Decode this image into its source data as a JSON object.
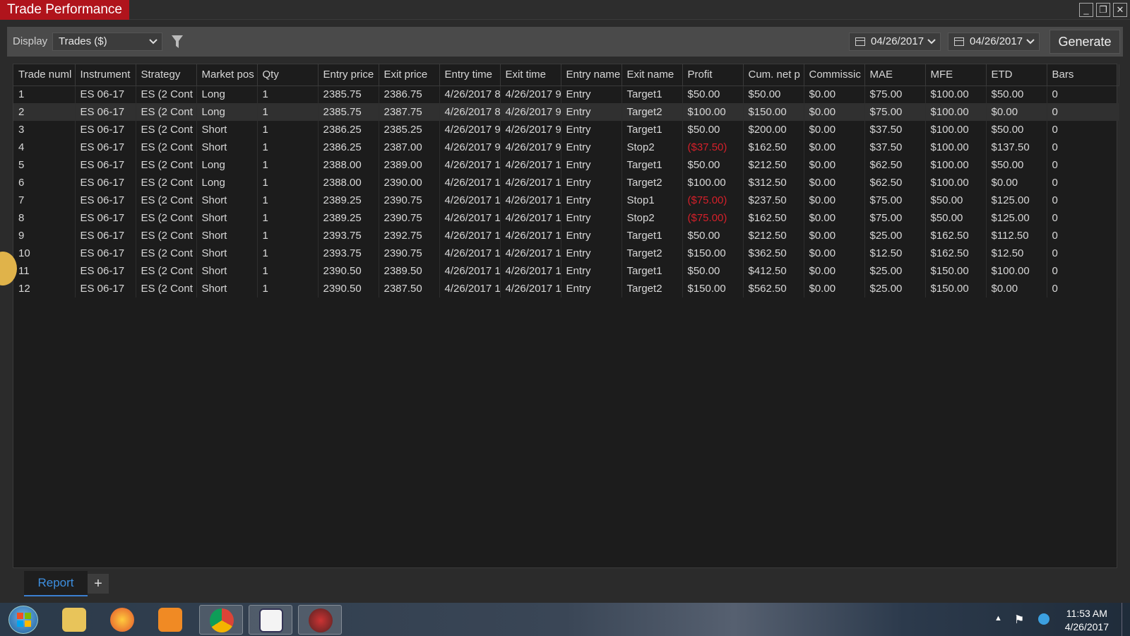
{
  "window": {
    "title": "Trade Performance",
    "controls": {
      "minimize": "_",
      "restore": "❐",
      "close": "✕"
    }
  },
  "toolbar": {
    "display_label": "Display",
    "display_value": "Trades ($)",
    "date_from": "04/26/2017",
    "date_to": "04/26/2017",
    "generate_label": "Generate",
    "icons": [
      "chevron-down-icon",
      "filter-icon",
      "calendar-icon"
    ]
  },
  "grid": {
    "columns": [
      "Trade numl",
      "Instrument",
      "Strategy",
      "Market pos",
      "Qty",
      "Entry price",
      "Exit price",
      "Entry time",
      "Exit time",
      "Entry name",
      "Exit name",
      "Profit",
      "Cum. net p",
      "Commissic",
      "MAE",
      "MFE",
      "ETD",
      "Bars"
    ],
    "selected_row": 1,
    "rows": [
      [
        "1",
        "ES 06-17",
        "ES (2 Cont",
        "Long",
        "1",
        "2385.75",
        "2386.75",
        "4/26/2017 8",
        "4/26/2017 9",
        "Entry",
        "Target1",
        "$50.00",
        "$50.00",
        "$0.00",
        "$75.00",
        "$100.00",
        "$50.00",
        "0"
      ],
      [
        "2",
        "ES 06-17",
        "ES (2 Cont",
        "Long",
        "1",
        "2385.75",
        "2387.75",
        "4/26/2017 8",
        "4/26/2017 9",
        "Entry",
        "Target2",
        "$100.00",
        "$150.00",
        "$0.00",
        "$75.00",
        "$100.00",
        "$0.00",
        "0"
      ],
      [
        "3",
        "ES 06-17",
        "ES (2 Cont",
        "Short",
        "1",
        "2386.25",
        "2385.25",
        "4/26/2017 9",
        "4/26/2017 9",
        "Entry",
        "Target1",
        "$50.00",
        "$200.00",
        "$0.00",
        "$37.50",
        "$100.00",
        "$50.00",
        "0"
      ],
      [
        "4",
        "ES 06-17",
        "ES (2 Cont",
        "Short",
        "1",
        "2386.25",
        "2387.00",
        "4/26/2017 9",
        "4/26/2017 9",
        "Entry",
        "Stop2",
        "($37.50)",
        "$162.50",
        "$0.00",
        "$37.50",
        "$100.00",
        "$137.50",
        "0"
      ],
      [
        "5",
        "ES 06-17",
        "ES (2 Cont",
        "Long",
        "1",
        "2388.00",
        "2389.00",
        "4/26/2017 1",
        "4/26/2017 1",
        "Entry",
        "Target1",
        "$50.00",
        "$212.50",
        "$0.00",
        "$62.50",
        "$100.00",
        "$50.00",
        "0"
      ],
      [
        "6",
        "ES 06-17",
        "ES (2 Cont",
        "Long",
        "1",
        "2388.00",
        "2390.00",
        "4/26/2017 1",
        "4/26/2017 1",
        "Entry",
        "Target2",
        "$100.00",
        "$312.50",
        "$0.00",
        "$62.50",
        "$100.00",
        "$0.00",
        "0"
      ],
      [
        "7",
        "ES 06-17",
        "ES (2 Cont",
        "Short",
        "1",
        "2389.25",
        "2390.75",
        "4/26/2017 1",
        "4/26/2017 1",
        "Entry",
        "Stop1",
        "($75.00)",
        "$237.50",
        "$0.00",
        "$75.00",
        "$50.00",
        "$125.00",
        "0"
      ],
      [
        "8",
        "ES 06-17",
        "ES (2 Cont",
        "Short",
        "1",
        "2389.25",
        "2390.75",
        "4/26/2017 1",
        "4/26/2017 1",
        "Entry",
        "Stop2",
        "($75.00)",
        "$162.50",
        "$0.00",
        "$75.00",
        "$50.00",
        "$125.00",
        "0"
      ],
      [
        "9",
        "ES 06-17",
        "ES (2 Cont",
        "Short",
        "1",
        "2393.75",
        "2392.75",
        "4/26/2017 1",
        "4/26/2017 1",
        "Entry",
        "Target1",
        "$50.00",
        "$212.50",
        "$0.00",
        "$25.00",
        "$162.50",
        "$112.50",
        "0"
      ],
      [
        "10",
        "ES 06-17",
        "ES (2 Cont",
        "Short",
        "1",
        "2393.75",
        "2390.75",
        "4/26/2017 1",
        "4/26/2017 1",
        "Entry",
        "Target2",
        "$150.00",
        "$362.50",
        "$0.00",
        "$12.50",
        "$162.50",
        "$12.50",
        "0"
      ],
      [
        "11",
        "ES 06-17",
        "ES (2 Cont",
        "Short",
        "1",
        "2390.50",
        "2389.50",
        "4/26/2017 1",
        "4/26/2017 1",
        "Entry",
        "Target1",
        "$50.00",
        "$412.50",
        "$0.00",
        "$25.00",
        "$150.00",
        "$100.00",
        "0"
      ],
      [
        "12",
        "ES 06-17",
        "ES (2 Cont",
        "Short",
        "1",
        "2390.50",
        "2387.50",
        "4/26/2017 1",
        "4/26/2017 1",
        "Entry",
        "Target2",
        "$150.00",
        "$562.50",
        "$0.00",
        "$25.00",
        "$150.00",
        "$0.00",
        "0"
      ]
    ]
  },
  "tabs": {
    "report_label": "Report",
    "add_label": "+"
  },
  "colors": {
    "title_tab": "#b0141c",
    "negative": "#d4202a",
    "active_tab": "#3d8fe0"
  },
  "taskbar": {
    "apps": [
      "windows-start-icon",
      "file-explorer-icon",
      "firefox-icon",
      "media-player-icon",
      "chrome-icon",
      "calculator-icon",
      "ninjatrader-icon"
    ],
    "clock_time": "11:53 AM",
    "clock_date": "4/26/2017"
  }
}
